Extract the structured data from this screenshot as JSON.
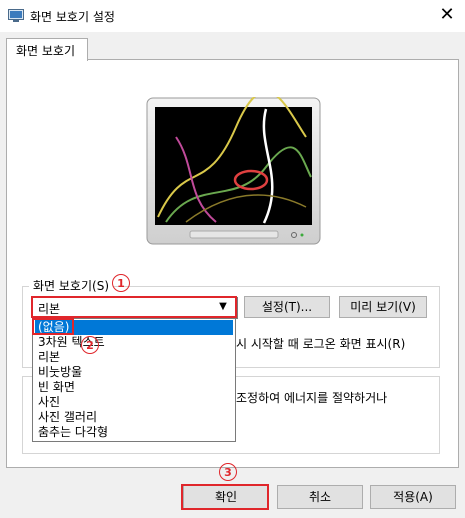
{
  "window": {
    "title": "화면 보호기 설정",
    "close_glyph": "✕"
  },
  "tabs": [
    {
      "label": "화면 보호기"
    }
  ],
  "group": {
    "label": "화면 보호기(S)"
  },
  "select": {
    "current": "리본"
  },
  "dropdown": {
    "options": [
      "(없음)",
      "3차원 텍스트",
      "리본",
      "비눗방울",
      "빈 화면",
      "사진",
      "사진 갤러리",
      "춤추는 다각형"
    ]
  },
  "buttons": {
    "settings": "설정(T)...",
    "preview": "미리 보기(V)",
    "ok": "확인",
    "cancel": "취소",
    "apply": "적용(A)"
  },
  "logon_text": "시 시작할 때 로그온 화면 표시(R)",
  "energy_text": "조정하여 에너지를 절약하거나",
  "badges": {
    "one": "1",
    "two": "2",
    "three": "3"
  },
  "colors": {
    "highlight": "#0078d7",
    "annotation": "#e0262b"
  }
}
